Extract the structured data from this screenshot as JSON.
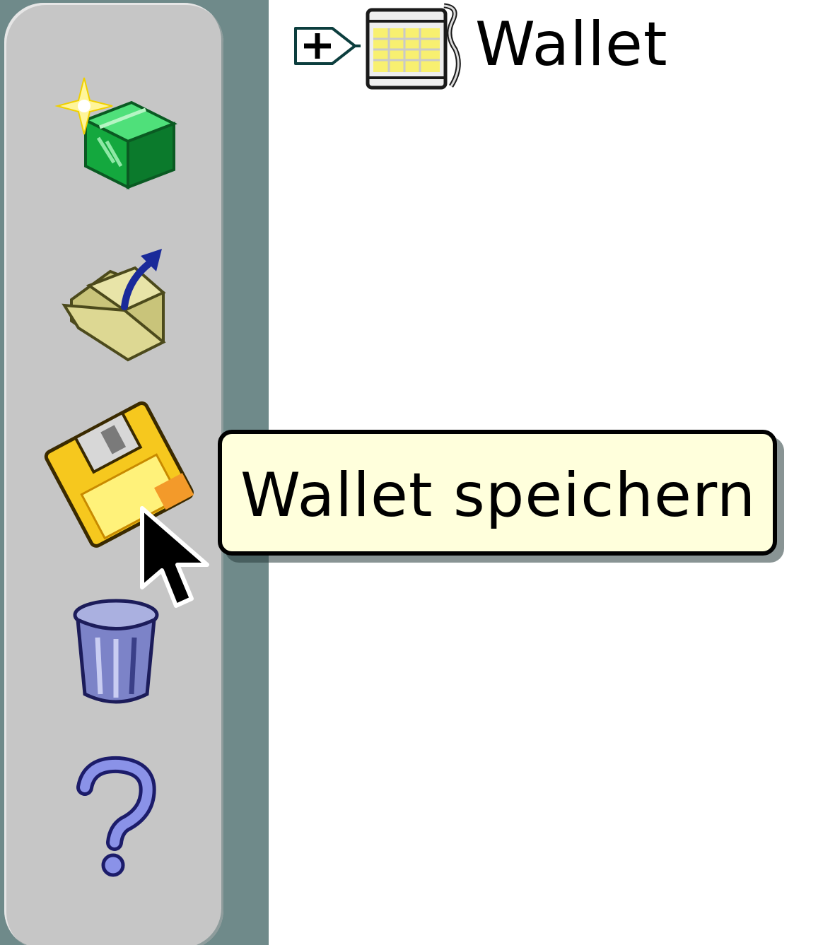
{
  "toolbar": {
    "buttons": [
      {
        "icon": "new-wallet-icon"
      },
      {
        "icon": "open-folder-icon"
      },
      {
        "icon": "save-floppy-icon"
      },
      {
        "icon": "trash-icon"
      },
      {
        "icon": "help-icon"
      }
    ]
  },
  "tree": {
    "items": [
      {
        "label": "Wallet",
        "icon": "wallet-icon",
        "expander_icon": "plus-expander-icon"
      }
    ]
  },
  "tooltip": {
    "text": "Wallet speichern"
  },
  "colors": {
    "sidebar_frame": "#6f8a8a",
    "toolbar_bg": "#c6c6c6",
    "tooltip_bg": "#ffffdc",
    "tree_bg": "#ffffff"
  }
}
